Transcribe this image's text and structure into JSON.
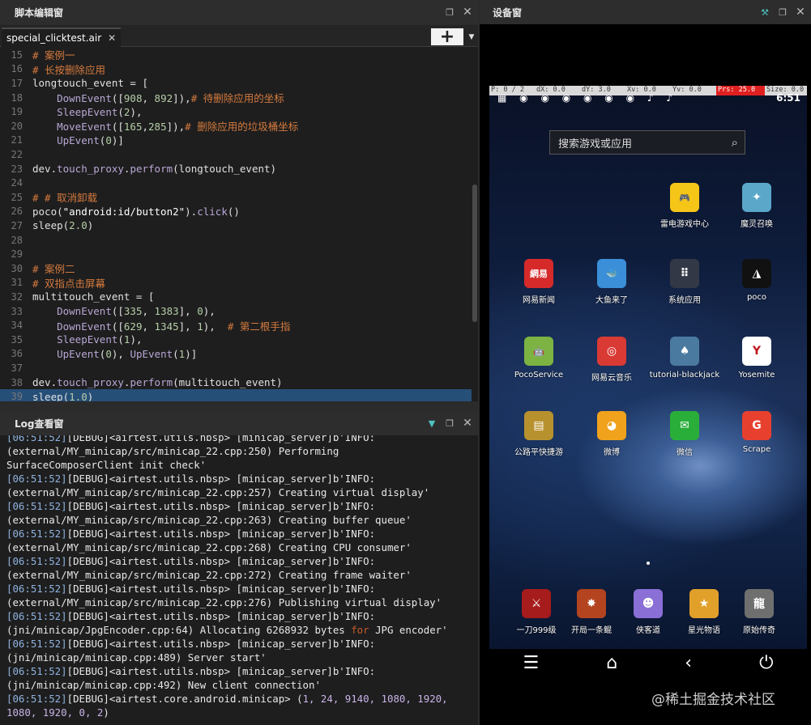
{
  "editor": {
    "title": "脚本编辑窗",
    "tab_name": "special_clicktest.air",
    "add_label": "+"
  },
  "code_lines": [
    {
      "n": "15",
      "parts": [
        {
          "t": "# 案例一",
          "c": "com"
        }
      ]
    },
    {
      "n": "16",
      "parts": [
        {
          "t": "# 长按删除应用",
          "c": "com"
        }
      ]
    },
    {
      "n": "17",
      "parts": [
        {
          "t": "longtouch_event = [",
          "c": ""
        }
      ]
    },
    {
      "n": "18",
      "parts": [
        {
          "t": "    ",
          "c": ""
        },
        {
          "t": "DownEvent",
          "c": "fn"
        },
        {
          "t": "([",
          "c": ""
        },
        {
          "t": "908",
          "c": "num"
        },
        {
          "t": ", ",
          "c": ""
        },
        {
          "t": "892",
          "c": "num"
        },
        {
          "t": "]),",
          "c": ""
        },
        {
          "t": "# 待删除应用的坐标",
          "c": "com"
        }
      ]
    },
    {
      "n": "19",
      "parts": [
        {
          "t": "    ",
          "c": ""
        },
        {
          "t": "SleepEvent",
          "c": "fn"
        },
        {
          "t": "(",
          "c": ""
        },
        {
          "t": "2",
          "c": "num"
        },
        {
          "t": "),",
          "c": ""
        }
      ]
    },
    {
      "n": "20",
      "parts": [
        {
          "t": "    ",
          "c": ""
        },
        {
          "t": "MoveEvent",
          "c": "fn"
        },
        {
          "t": "([",
          "c": ""
        },
        {
          "t": "165",
          "c": "num"
        },
        {
          "t": ",",
          "c": ""
        },
        {
          "t": "285",
          "c": "num"
        },
        {
          "t": "]),",
          "c": ""
        },
        {
          "t": "# 删除应用的垃圾桶坐标",
          "c": "com"
        }
      ]
    },
    {
      "n": "21",
      "parts": [
        {
          "t": "    ",
          "c": ""
        },
        {
          "t": "UpEvent",
          "c": "fn"
        },
        {
          "t": "(",
          "c": ""
        },
        {
          "t": "0",
          "c": "num"
        },
        {
          "t": ")]",
          "c": ""
        }
      ]
    },
    {
      "n": "22",
      "parts": []
    },
    {
      "n": "23",
      "parts": [
        {
          "t": "dev.",
          "c": ""
        },
        {
          "t": "touch_proxy",
          "c": "fn"
        },
        {
          "t": ".",
          "c": ""
        },
        {
          "t": "perform",
          "c": "fn"
        },
        {
          "t": "(longtouch_event)",
          "c": ""
        }
      ]
    },
    {
      "n": "24",
      "parts": []
    },
    {
      "n": "25",
      "parts": [
        {
          "t": "# # 取消卸载",
          "c": "com"
        }
      ]
    },
    {
      "n": "26",
      "parts": [
        {
          "t": "poco(",
          "c": ""
        },
        {
          "t": "\"android:id/button2\"",
          "c": "str"
        },
        {
          "t": ").",
          "c": ""
        },
        {
          "t": "click",
          "c": "fn"
        },
        {
          "t": "()",
          "c": ""
        }
      ]
    },
    {
      "n": "27",
      "parts": [
        {
          "t": "sleep(",
          "c": ""
        },
        {
          "t": "2.0",
          "c": "num"
        },
        {
          "t": ")",
          "c": ""
        }
      ]
    },
    {
      "n": "28",
      "parts": []
    },
    {
      "n": "29",
      "parts": []
    },
    {
      "n": "30",
      "parts": [
        {
          "t": "# 案例二",
          "c": "com"
        }
      ]
    },
    {
      "n": "31",
      "parts": [
        {
          "t": "# 双指点击屏幕",
          "c": "com"
        }
      ]
    },
    {
      "n": "32",
      "parts": [
        {
          "t": "multitouch_event = [",
          "c": ""
        }
      ]
    },
    {
      "n": "33",
      "parts": [
        {
          "t": "    ",
          "c": ""
        },
        {
          "t": "DownEvent",
          "c": "fn"
        },
        {
          "t": "([",
          "c": ""
        },
        {
          "t": "335",
          "c": "num"
        },
        {
          "t": ", ",
          "c": ""
        },
        {
          "t": "1383",
          "c": "num"
        },
        {
          "t": "], ",
          "c": ""
        },
        {
          "t": "0",
          "c": "num"
        },
        {
          "t": "),",
          "c": ""
        }
      ]
    },
    {
      "n": "34",
      "parts": [
        {
          "t": "    ",
          "c": ""
        },
        {
          "t": "DownEvent",
          "c": "fn"
        },
        {
          "t": "([",
          "c": ""
        },
        {
          "t": "629",
          "c": "num"
        },
        {
          "t": ", ",
          "c": ""
        },
        {
          "t": "1345",
          "c": "num"
        },
        {
          "t": "], ",
          "c": ""
        },
        {
          "t": "1",
          "c": "num"
        },
        {
          "t": "),  ",
          "c": ""
        },
        {
          "t": "# 第二根手指",
          "c": "com"
        }
      ]
    },
    {
      "n": "35",
      "parts": [
        {
          "t": "    ",
          "c": ""
        },
        {
          "t": "SleepEvent",
          "c": "fn"
        },
        {
          "t": "(",
          "c": ""
        },
        {
          "t": "1",
          "c": "num"
        },
        {
          "t": "),",
          "c": ""
        }
      ]
    },
    {
      "n": "36",
      "parts": [
        {
          "t": "    ",
          "c": ""
        },
        {
          "t": "UpEvent",
          "c": "fn"
        },
        {
          "t": "(",
          "c": ""
        },
        {
          "t": "0",
          "c": "num"
        },
        {
          "t": "), ",
          "c": ""
        },
        {
          "t": "UpEvent",
          "c": "fn"
        },
        {
          "t": "(",
          "c": ""
        },
        {
          "t": "1",
          "c": "num"
        },
        {
          "t": ")]",
          "c": ""
        }
      ]
    },
    {
      "n": "37",
      "parts": []
    },
    {
      "n": "38",
      "parts": [
        {
          "t": "dev.",
          "c": ""
        },
        {
          "t": "touch_proxy",
          "c": "fn"
        },
        {
          "t": ".",
          "c": ""
        },
        {
          "t": "perform",
          "c": "fn"
        },
        {
          "t": "(multitouch_event)",
          "c": ""
        }
      ]
    },
    {
      "n": "39",
      "parts": [
        {
          "t": "sleep(",
          "c": ""
        },
        {
          "t": "1.0",
          "c": "num"
        },
        {
          "t": ")",
          "c": ""
        }
      ],
      "active": true
    }
  ],
  "log": {
    "title": "Log查看窗",
    "lines": [
      [
        {
          "t": "[06:51:52]",
          "c": "ts"
        },
        {
          "t": "[DEBUG]<airtest.utils.nbsp> [minicap_server]b'INFO:",
          "c": ""
        }
      ],
      [
        {
          "t": "(external/MY_minicap/src/minicap_22.cpp:250) Performing",
          "c": ""
        }
      ],
      [
        {
          "t": "SurfaceComposerClient init check'",
          "c": ""
        }
      ],
      [
        {
          "t": "[06:51:52]",
          "c": "ts"
        },
        {
          "t": "[DEBUG]<airtest.utils.nbsp> [minicap_server]b'INFO:",
          "c": ""
        }
      ],
      [
        {
          "t": "(external/MY_minicap/src/minicap_22.cpp:257) Creating virtual display'",
          "c": ""
        }
      ],
      [
        {
          "t": "[06:51:52]",
          "c": "ts"
        },
        {
          "t": "[DEBUG]<airtest.utils.nbsp> [minicap_server]b'INFO:",
          "c": ""
        }
      ],
      [
        {
          "t": "(external/MY_minicap/src/minicap_22.cpp:263) Creating buffer queue'",
          "c": ""
        }
      ],
      [
        {
          "t": "[06:51:52]",
          "c": "ts"
        },
        {
          "t": "[DEBUG]<airtest.utils.nbsp> [minicap_server]b'INFO:",
          "c": ""
        }
      ],
      [
        {
          "t": "(external/MY_minicap/src/minicap_22.cpp:268) Creating CPU consumer'",
          "c": ""
        }
      ],
      [
        {
          "t": "[06:51:52]",
          "c": "ts"
        },
        {
          "t": "[DEBUG]<airtest.utils.nbsp> [minicap_server]b'INFO:",
          "c": ""
        }
      ],
      [
        {
          "t": "(external/MY_minicap/src/minicap_22.cpp:272) Creating frame waiter'",
          "c": ""
        }
      ],
      [
        {
          "t": "[06:51:52]",
          "c": "ts"
        },
        {
          "t": "[DEBUG]<airtest.utils.nbsp> [minicap_server]b'INFO:",
          "c": ""
        }
      ],
      [
        {
          "t": "(external/MY_minicap/src/minicap_22.cpp:276) Publishing virtual display'",
          "c": ""
        }
      ],
      [
        {
          "t": "[06:51:52]",
          "c": "ts"
        },
        {
          "t": "[DEBUG]<airtest.utils.nbsp> [minicap_server]b'INFO:",
          "c": ""
        }
      ],
      [
        {
          "t": "(jni/minicap/JpgEncoder.cpp:64) Allocating 6268932 bytes ",
          "c": ""
        },
        {
          "t": "for",
          "c": "kw"
        },
        {
          "t": " JPG encoder'",
          "c": ""
        }
      ],
      [
        {
          "t": "[06:51:52]",
          "c": "ts"
        },
        {
          "t": "[DEBUG]<airtest.utils.nbsp> [minicap_server]b'INFO:",
          "c": ""
        }
      ],
      [
        {
          "t": "(jni/minicap/minicap.cpp:489) Server start'",
          "c": ""
        }
      ],
      [
        {
          "t": "[06:51:52]",
          "c": "ts"
        },
        {
          "t": "[DEBUG]<airtest.utils.nbsp> [minicap_server]b'INFO:",
          "c": ""
        }
      ],
      [
        {
          "t": "(jni/minicap/minicap.cpp:492) New client connection'",
          "c": ""
        }
      ],
      [
        {
          "t": "[06:51:52]",
          "c": "ts"
        },
        {
          "t": "[DEBUG]<airtest.core.android.minicap> (",
          "c": ""
        },
        {
          "t": "1, 24, 9140, 1080, 1920,",
          "c": "nm"
        }
      ],
      [
        {
          "t": "1080, 1920, 0, 2",
          "c": "nm"
        },
        {
          "t": ")",
          "c": ""
        }
      ]
    ]
  },
  "device": {
    "title": "设备窗",
    "debug_bar": [
      "P: 0 / 2",
      "dX: 0.0",
      "dY: 3.0",
      "Xv: 0.0",
      "Yv: 0.0",
      "Prs: 25.0",
      "Size: 0.0"
    ],
    "status_icons": "▦ ◉ ◉ ◉ ◉ ◉ ◉ ♪ ♪",
    "time": "6:51",
    "search_placeholder": "搜索游戏或应用",
    "apps": [
      {
        "label": "雷电游戏中心",
        "glyph": "🎮",
        "color": "#f5c518"
      },
      {
        "label": "魔灵召唤",
        "glyph": "✦",
        "color": "#5aa7c9"
      },
      {
        "label": "网易新闻",
        "glyph": "網易",
        "color": "#d62a2a"
      },
      {
        "label": "大鱼来了",
        "glyph": "🐳",
        "color": "#3a8fd8"
      },
      {
        "label": "系统应用",
        "glyph": "⠿",
        "color": "#333846"
      },
      {
        "label": "poco",
        "glyph": "◮",
        "color": "#111111"
      },
      {
        "label": "PocoService",
        "glyph": "🤖",
        "color": "#7cb342"
      },
      {
        "label": "网易云音乐",
        "glyph": "◎",
        "color": "#d93a34"
      },
      {
        "label": "tutorial-blackjack",
        "glyph": "♠",
        "color": "#4a7aa0"
      },
      {
        "label": "Yosemite",
        "glyph": "Y",
        "color": "#ffffff"
      },
      {
        "label": "公路平快捷游",
        "glyph": "▤",
        "color": "#b8912f"
      },
      {
        "label": "微博",
        "glyph": "◕",
        "color": "#f0a21c"
      },
      {
        "label": "微信",
        "glyph": "✉",
        "color": "#2aae3a"
      },
      {
        "label": "Scrape",
        "glyph": "G",
        "color": "#e8402f"
      }
    ],
    "dock": [
      {
        "label": "一刀999级",
        "glyph": "⚔",
        "color": "#a61b1b"
      },
      {
        "label": "开局一条鲲",
        "glyph": "✸",
        "color": "#b3441f"
      },
      {
        "label": "侠客道",
        "glyph": "☻",
        "color": "#8a6fd6"
      },
      {
        "label": "星光物语",
        "glyph": "★",
        "color": "#e0a02a"
      },
      {
        "label": "原始传奇",
        "glyph": "龍",
        "color": "#6f6f6f"
      }
    ],
    "nav": [
      "☰",
      "⌂",
      "‹",
      "⏻"
    ]
  },
  "watermark": "@稀土掘金技术社区"
}
